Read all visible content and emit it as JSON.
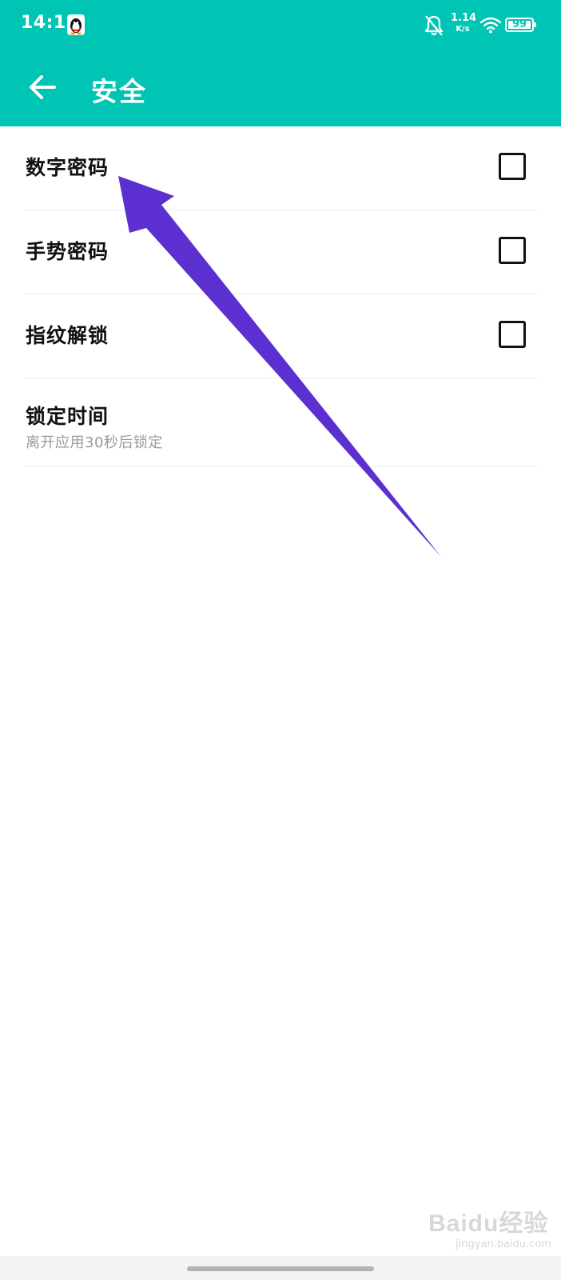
{
  "status_bar": {
    "time": "14:16",
    "net_speed_value": "1.14",
    "net_speed_unit": "K/s",
    "battery_level": "99",
    "icons": [
      "qq-icon",
      "bell-off-icon",
      "wifi-icon",
      "battery-icon"
    ]
  },
  "header": {
    "title": "安全",
    "back_icon": "arrow-left-icon"
  },
  "settings": [
    {
      "label": "数字密码",
      "checked": false
    },
    {
      "label": "手势密码",
      "checked": false
    },
    {
      "label": "指纹解锁",
      "checked": false
    }
  ],
  "lock_time": {
    "label": "锁定时间",
    "subtitle": "离开应用30秒后锁定"
  },
  "annotation": {
    "type": "arrow",
    "color": "#5b2fd0",
    "points_to": "数字密码"
  },
  "watermark": {
    "logo": "Baidu经验",
    "url": "jingyan.baidu.com"
  },
  "colors": {
    "header": "#00c4b4",
    "text": "#111111",
    "subtitle": "#9a9a9a",
    "divider": "#ececec"
  }
}
